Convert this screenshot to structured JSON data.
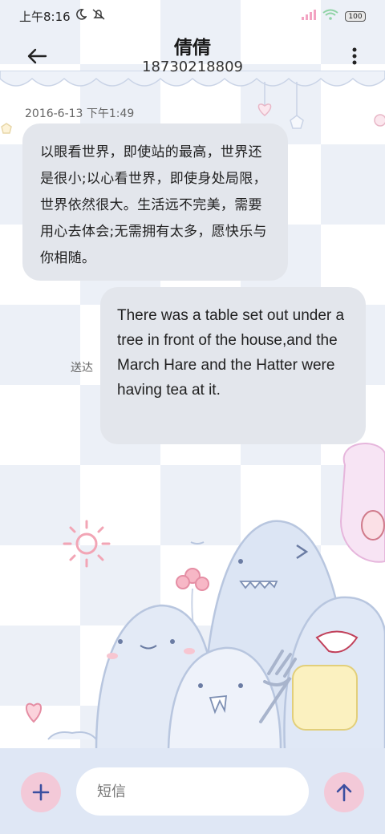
{
  "status_bar": {
    "time": "上午8:16",
    "battery": "100"
  },
  "header": {
    "contact_name": "倩倩",
    "phone_number": "18730218809"
  },
  "conversation": {
    "timestamp": "2016-6-13 下午1:49",
    "messages": [
      {
        "direction": "incoming",
        "text": "以眼看世界，即使站的最高，世界还是很小;以心看世界，即使身处局限，世界依然很大。生活远不完美，需要用心去体会;无需拥有太多，愿快乐与你相随。"
      },
      {
        "direction": "outgoing",
        "text": "There was a table set out under a tree in front of the house,and the March Hare and the Hatter were having tea at it.",
        "status": "送达"
      }
    ]
  },
  "composer": {
    "placeholder": "短信"
  },
  "colors": {
    "bubble": "#e3e6ec",
    "input_bar": "#dfe7f5",
    "accent_button": "#f3c9d8",
    "icon": "#3b4fa0"
  },
  "icons": {
    "back": "arrow-left-icon",
    "more": "more-vertical-icon",
    "add": "plus-icon",
    "send": "arrow-up-icon"
  }
}
